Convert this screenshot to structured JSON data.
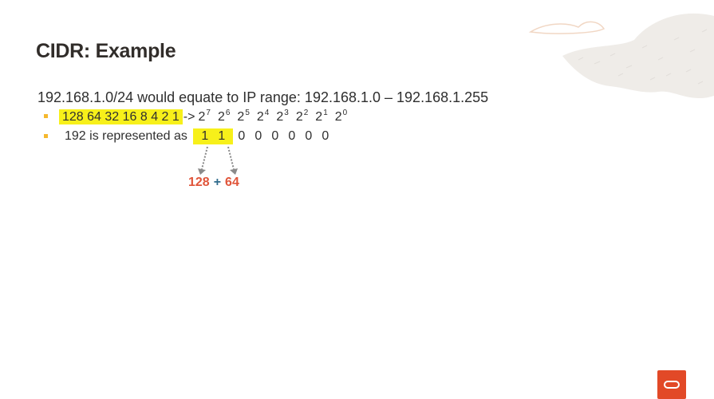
{
  "slide": {
    "title": "CIDR: Example",
    "main_line": "192.168.1.0/24 would equate to IP range: 192.168.1.0 – 192.168.1.255",
    "bullet1": {
      "highlight": "128 64 32 16 8 4 2 1",
      "arrow": "->",
      "powers": [
        {
          "base": "2",
          "exp": "7"
        },
        {
          "base": "2",
          "exp": "6"
        },
        {
          "base": "2",
          "exp": "5"
        },
        {
          "base": "2",
          "exp": "4"
        },
        {
          "base": "2",
          "exp": "3"
        },
        {
          "base": "2",
          "exp": "2"
        },
        {
          "base": "2",
          "exp": "1"
        },
        {
          "base": "2",
          "exp": "0"
        }
      ]
    },
    "bullet2": {
      "label": "192 is represented as",
      "bits": [
        "1",
        "1",
        "0",
        "0",
        "0",
        "0",
        "0",
        "0"
      ]
    },
    "sum": {
      "a": "128",
      "plus": "+",
      "b": "64"
    }
  },
  "colors": {
    "highlight": "#f7f01a",
    "bullet": "#f5b82e",
    "sum_number": "#e0553a",
    "sum_plus": "#2f6b8c",
    "logo": "#e24927"
  }
}
